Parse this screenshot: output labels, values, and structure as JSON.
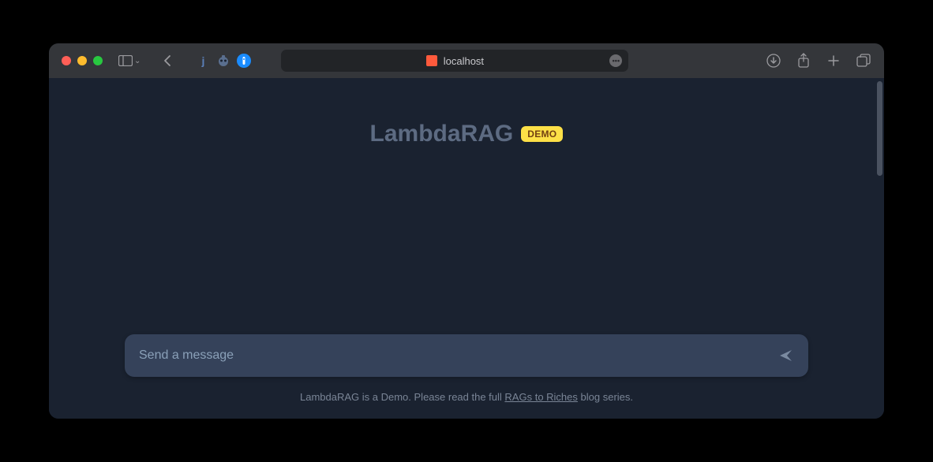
{
  "browser": {
    "address": "localhost",
    "extensions": {
      "j_label": "j"
    }
  },
  "app": {
    "title": "LambdaRAG",
    "badge": "DEMO"
  },
  "composer": {
    "placeholder": "Send a message"
  },
  "footer": {
    "prefix": "LambdaRAG is a Demo. Please read the full ",
    "link_text": "RAGs to Riches",
    "suffix": " blog series."
  }
}
